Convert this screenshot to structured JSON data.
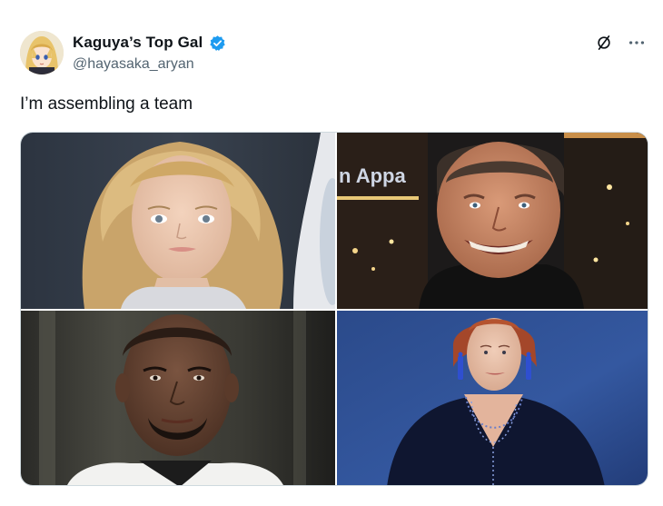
{
  "author": {
    "display_name": "Kaguya’s Top Gal",
    "handle": "@hayasaka_aryan",
    "verified": true,
    "avatar_icon": "anime-girl-avatar"
  },
  "tweet": {
    "text": "I’m assembling a team"
  },
  "top_actions": {
    "grok_icon": "slashed-circle-icon",
    "more_icon": "more-dots-icon"
  },
  "media": {
    "images": [
      {
        "name": "blonde-woman-photo",
        "overlay_text": ""
      },
      {
        "name": "smiling-man-photo",
        "overlay_text": "n Appa"
      },
      {
        "name": "bald-man-photo",
        "overlay_text": ""
      },
      {
        "name": "red-haired-woman-photo",
        "overlay_text": ""
      }
    ]
  },
  "colors": {
    "verified_blue": "#1d9bf0",
    "text_primary": "#0f1419",
    "text_secondary": "#536471"
  }
}
